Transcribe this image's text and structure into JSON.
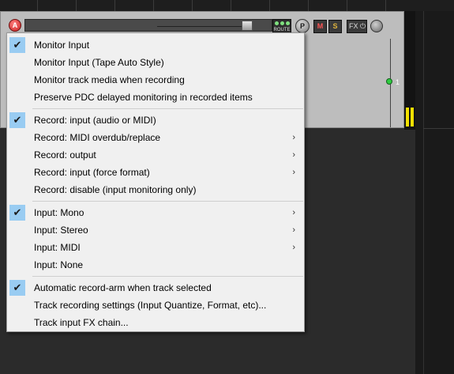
{
  "track_header": {
    "arm_button_label": "A",
    "route_label": "ROUTE",
    "pan_label": "P",
    "mute_label": "M",
    "solo_label": "S",
    "fx_label": "FX ⏻",
    "track_number": "1"
  },
  "menu": {
    "items": [
      {
        "label": "Monitor Input",
        "checked": true,
        "submenu": false
      },
      {
        "label": "Monitor Input (Tape Auto Style)",
        "checked": false,
        "submenu": false
      },
      {
        "label": "Monitor track media when recording",
        "checked": false,
        "submenu": false
      },
      {
        "label": "Preserve PDC delayed monitoring in recorded items",
        "checked": false,
        "submenu": false
      },
      {
        "label": "Record: input (audio or MIDI)",
        "checked": true,
        "submenu": false
      },
      {
        "label": "Record: MIDI overdub/replace",
        "checked": false,
        "submenu": true
      },
      {
        "label": "Record: output",
        "checked": false,
        "submenu": true
      },
      {
        "label": "Record: input (force format)",
        "checked": false,
        "submenu": true
      },
      {
        "label": "Record: disable (input monitoring only)",
        "checked": false,
        "submenu": false
      },
      {
        "label": "Input: Mono",
        "checked": true,
        "submenu": true
      },
      {
        "label": "Input: Stereo",
        "checked": false,
        "submenu": true
      },
      {
        "label": "Input: MIDI",
        "checked": false,
        "submenu": true
      },
      {
        "label": "Input: None",
        "checked": false,
        "submenu": false
      },
      {
        "label": "Automatic record-arm when track selected",
        "checked": true,
        "submenu": false
      },
      {
        "label": "Track recording settings (Input Quantize, Format, etc)...",
        "checked": false,
        "submenu": false
      },
      {
        "label": "Track input FX chain...",
        "checked": false,
        "submenu": false
      }
    ],
    "check_glyph": "✔",
    "arrow_glyph": "›"
  },
  "colors": {
    "check_highlight": "#99ccf2",
    "arm_red": "#d83232",
    "meter_yellow": "#f2e000",
    "envelope_green": "#2ecc40"
  }
}
